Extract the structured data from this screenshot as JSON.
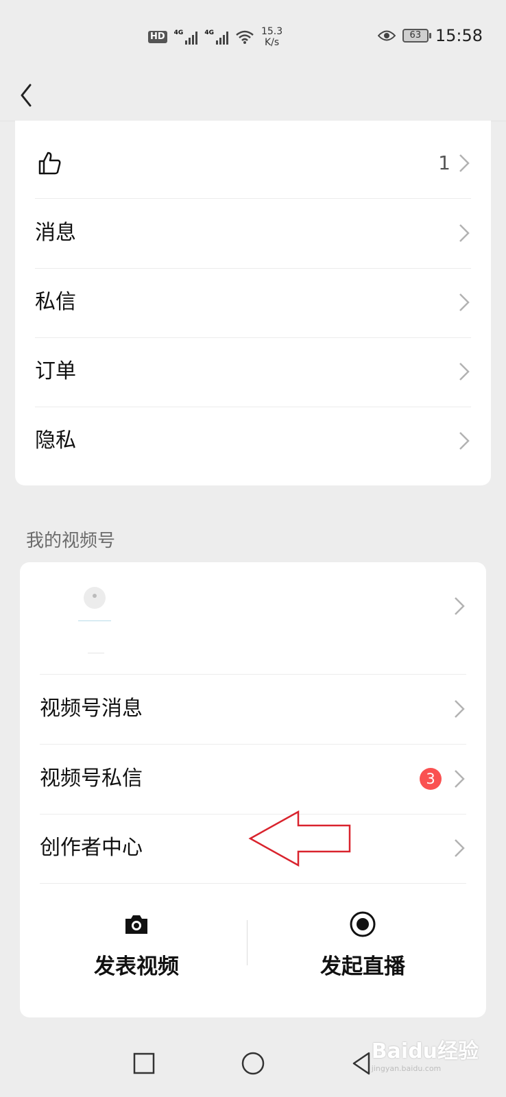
{
  "status_bar": {
    "hd": "HD",
    "net1": "4G",
    "net2": "4G",
    "speed_value": "15.3",
    "speed_unit": "K/s",
    "battery": "63",
    "time": "15:58"
  },
  "menu": {
    "like_count": "1",
    "items": [
      {
        "label": "消息"
      },
      {
        "label": "私信"
      },
      {
        "label": "订单"
      },
      {
        "label": "隐私"
      }
    ]
  },
  "channels": {
    "section_title": "我的视频号",
    "items": [
      {
        "label": "视频号消息"
      },
      {
        "label": "视频号私信",
        "badge": "3"
      },
      {
        "label": "创作者中心"
      }
    ],
    "actions": [
      {
        "label": "发表视频",
        "icon": "camera-icon"
      },
      {
        "label": "发起直播",
        "icon": "live-record-icon"
      }
    ]
  },
  "annotation": {
    "type": "red-outline-arrow",
    "color": "#d9232d"
  },
  "watermark": {
    "text": "Baidu经验",
    "sub": "jingyan.baidu.com"
  },
  "colors": {
    "background": "#ededed",
    "badge": "#fa5151"
  }
}
